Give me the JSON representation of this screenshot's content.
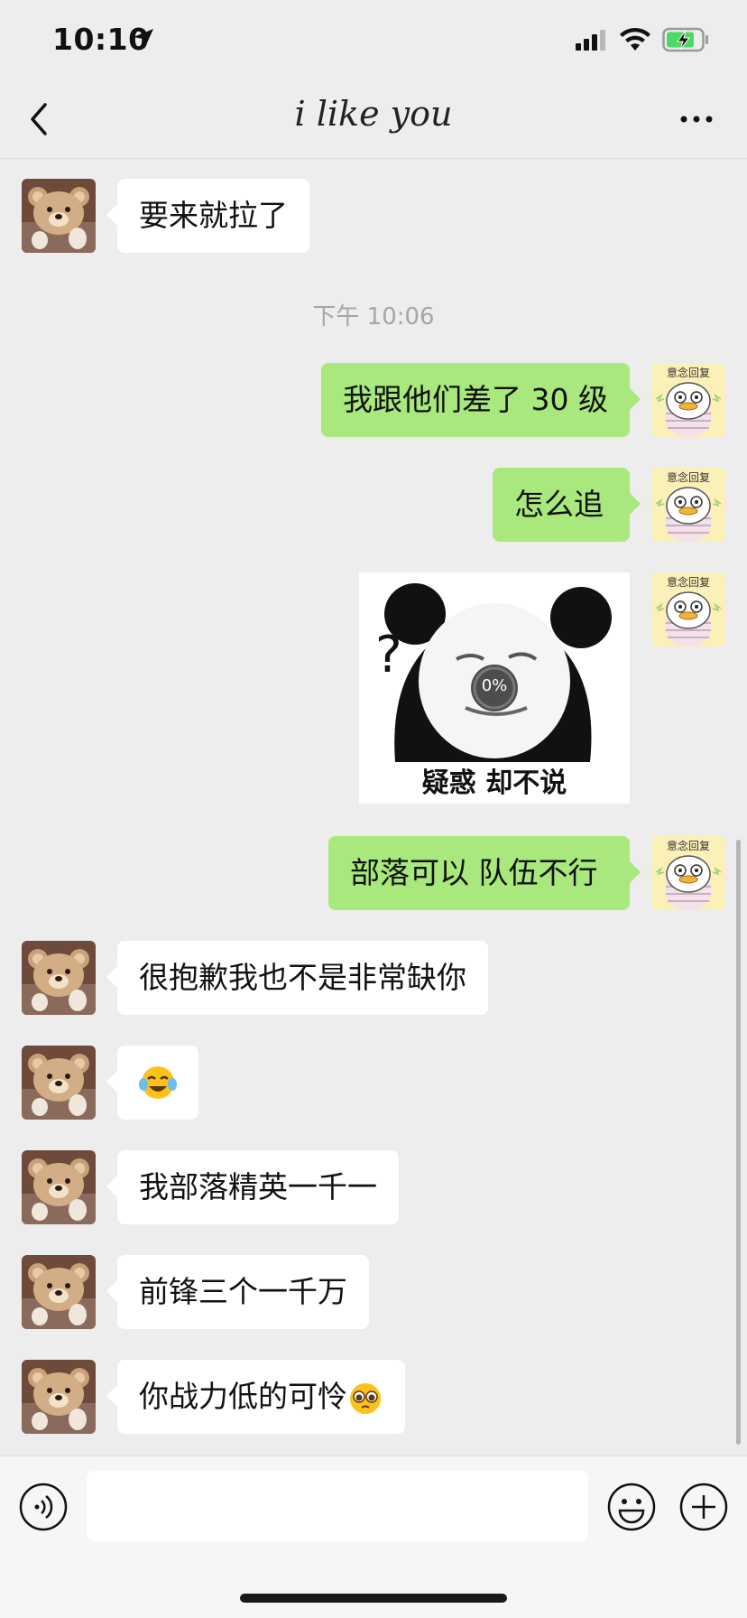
{
  "status_bar": {
    "time": "10:10",
    "location_icon": "location-arrow-icon",
    "signal_icon": "cellular-signal-icon",
    "wifi_icon": "wifi-icon",
    "battery_icon": "battery-charging-icon",
    "battery_color": "#4cd964"
  },
  "nav": {
    "title": "i like you",
    "back_icon": "chevron-left-icon",
    "more_icon": "more-dots-icon"
  },
  "chat": {
    "timestamp": "下午 10:06",
    "messages": [
      {
        "from": "friend",
        "type": "text",
        "text": "要来就拉了"
      },
      {
        "from": "me",
        "type": "text",
        "text": "我跟他们差了 30 级"
      },
      {
        "from": "me",
        "type": "text",
        "text": "怎么追"
      },
      {
        "from": "me",
        "type": "sticker",
        "caption": "疑惑 却不说",
        "progress": "0%"
      },
      {
        "from": "me",
        "type": "text",
        "text": "部落可以 队伍不行"
      },
      {
        "from": "friend",
        "type": "text",
        "text": "很抱歉我也不是非常缺你"
      },
      {
        "from": "friend",
        "type": "emoji",
        "emoji": "crying-laughing-emoji"
      },
      {
        "from": "friend",
        "type": "text",
        "text": "我部落精英一千一"
      },
      {
        "from": "friend",
        "type": "text",
        "text": "前锋三个一千万"
      },
      {
        "from": "friend",
        "type": "text",
        "text": "你战力低的可怜",
        "trailing_emoji": "pleading-face-emoji"
      }
    ],
    "my_avatar_label": "意念回复",
    "my_bubble_color": "#a8e87c",
    "friend_bubble_color": "#ffffff"
  },
  "input_bar": {
    "value": "",
    "voice_icon": "voice-icon",
    "emoji_icon": "emoji-icon",
    "plus_icon": "plus-icon"
  }
}
